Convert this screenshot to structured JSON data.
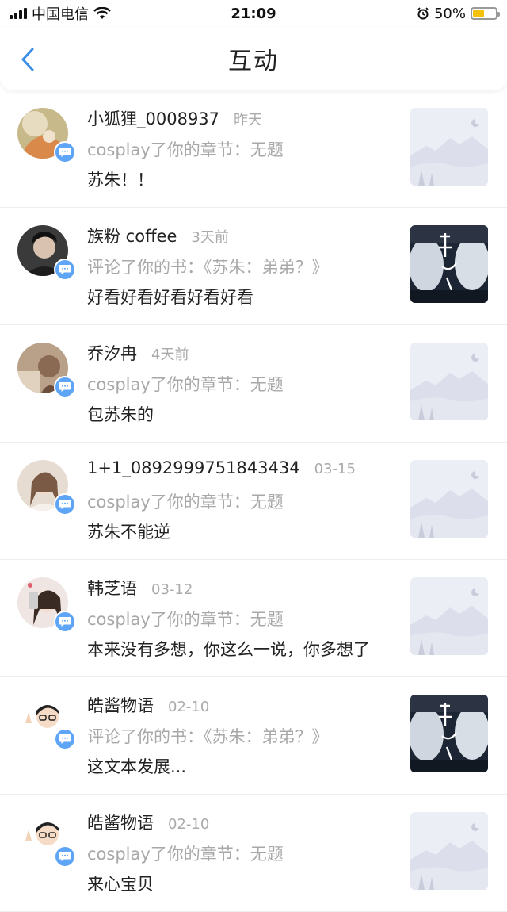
{
  "status_bar": {
    "carrier": "中国电信",
    "time": "21:09",
    "battery": "50%",
    "battery_level": 0.5
  },
  "nav": {
    "title": "互动"
  },
  "items": [
    {
      "name": "小狐狸_0008937",
      "time": "昨天",
      "action": "cosplay了你的章节：无题",
      "comment": "苏朱！！",
      "thumb": "placeholder",
      "avatar": "fox"
    },
    {
      "name": "族粉 coffee",
      "time": "3天前",
      "action": "评论了你的书：《苏朱：弟弟？》",
      "comment": "好看好看好看好看好看",
      "thumb": "cover",
      "avatar": "dark"
    },
    {
      "name": "乔汐冉",
      "time": "4天前",
      "action": "cosplay了你的章节：无题",
      "comment": "包苏朱的",
      "thumb": "placeholder",
      "avatar": "tan"
    },
    {
      "name": "1+1_0892999751843434",
      "time": "03-15",
      "action": "cosplay了你的章节：无题",
      "comment": "苏朱不能逆",
      "thumb": "placeholder",
      "avatar": "girl"
    },
    {
      "name": "韩芝语",
      "time": "03-12",
      "action": "cosplay了你的章节：无题",
      "comment": "本来没有多想，你这么一说，你多想了",
      "thumb": "placeholder",
      "avatar": "selfie"
    },
    {
      "name": "皓酱物语",
      "time": "02-10",
      "action": "评论了你的书：《苏朱：弟弟？》",
      "comment": "这文本发展...",
      "thumb": "cover",
      "avatar": "cartoon"
    },
    {
      "name": "皓酱物语",
      "time": "02-10",
      "action": "cosplay了你的章节：无题",
      "comment": "来心宝贝",
      "thumb": "placeholder",
      "avatar": "cartoon"
    }
  ]
}
